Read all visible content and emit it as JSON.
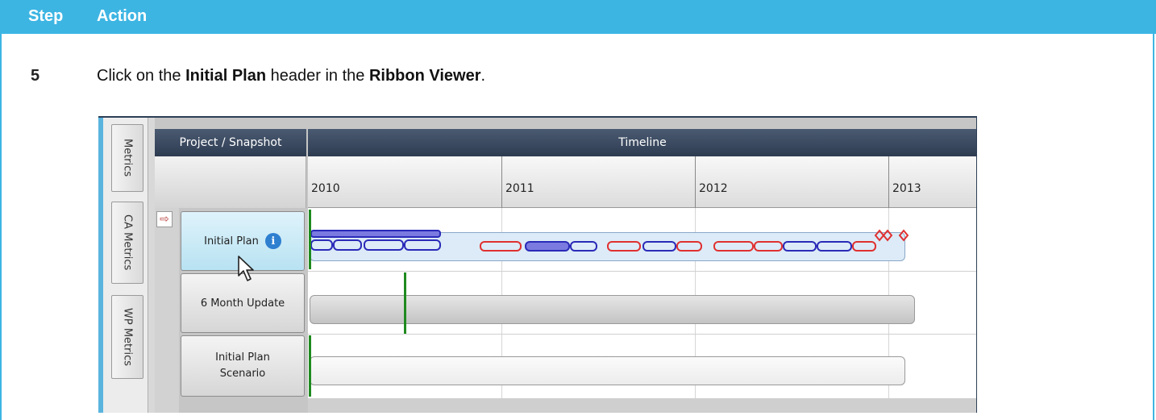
{
  "header": {
    "step_label": "Step",
    "action_label": "Action"
  },
  "step": {
    "number": "5",
    "text_pre": "Click on the ",
    "target1": "Initial Plan",
    "text_mid1": " header in the ",
    "target2": "Ribbon Viewer",
    "text_end": "."
  },
  "app": {
    "side_tabs": [
      "Metrics",
      "CA Metrics",
      "WP Metrics"
    ],
    "columns": {
      "project": "Project / Snapshot",
      "timeline": "Timeline"
    },
    "years": [
      "2010",
      "2011",
      "2012",
      "2013"
    ],
    "rows": [
      {
        "label": "Initial  Plan",
        "selected": true,
        "has_info_icon": true
      },
      {
        "label": "6 Month Update",
        "selected": false,
        "has_info_icon": false
      },
      {
        "label_line1": "Initial  Plan",
        "label_line2": "Scenario",
        "selected": false,
        "has_info_icon": false
      }
    ],
    "info_icon_glyph": "i",
    "arrow_glyph": "⇨",
    "colors": {
      "accent_header": "#3db5e3",
      "column_header": "#34445a",
      "selected_row": "#c4e8f5",
      "bar_blue": "#2a2ab8",
      "bar_red": "#e03030",
      "milestone": "#1f8a1f"
    }
  }
}
